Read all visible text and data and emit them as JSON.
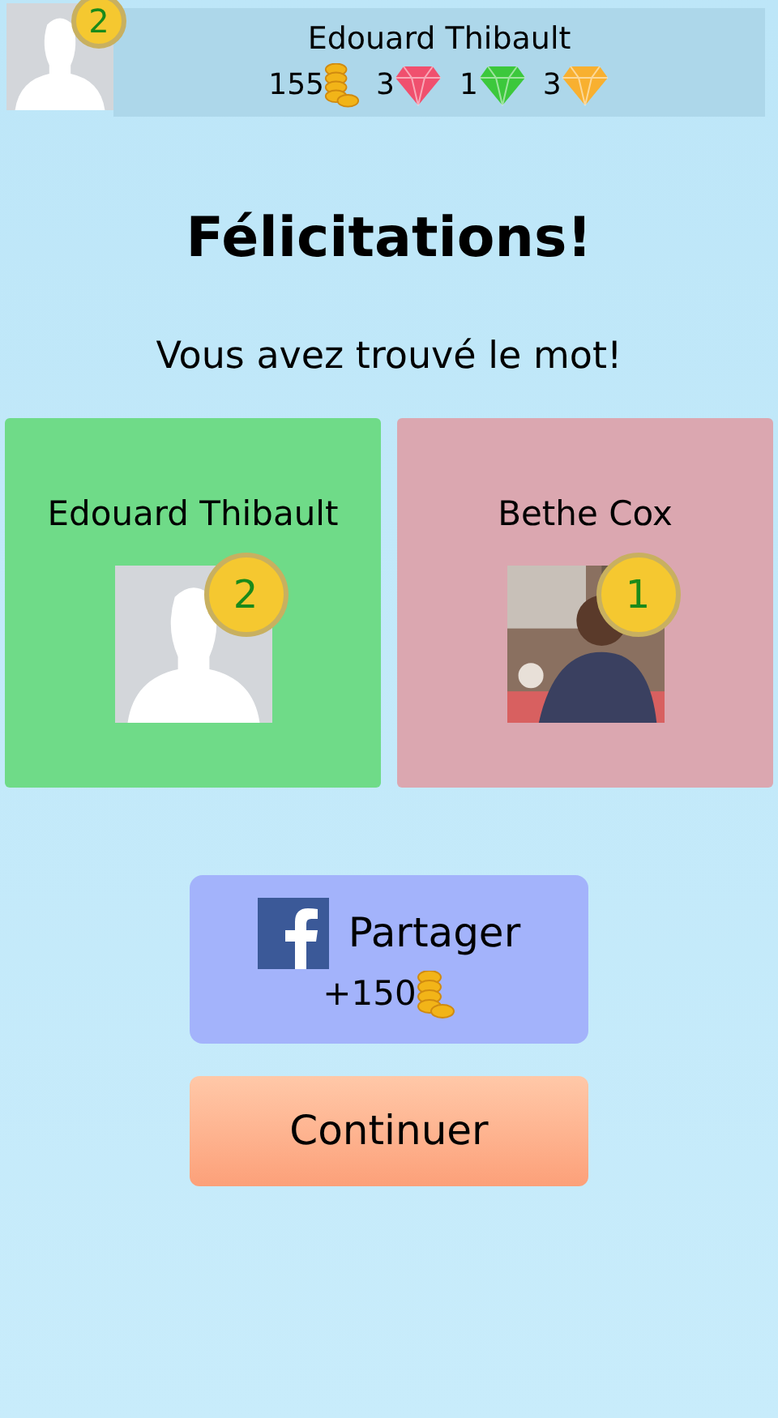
{
  "header": {
    "player": {
      "name": "Edouard Thibault",
      "rank": "2",
      "avatar": {
        "kind": "silhouette"
      }
    },
    "currencies": [
      {
        "kind": "coins",
        "amount": "155"
      },
      {
        "kind": "gem",
        "amount": "3",
        "color": "#f0506e"
      },
      {
        "kind": "gem",
        "amount": "1",
        "color": "#3cc83c"
      },
      {
        "kind": "gem",
        "amount": "3",
        "color": "#f8b030"
      }
    ]
  },
  "title": "Félicitations!",
  "message": "Vous avez trouvé le mot!",
  "players": [
    {
      "name": "Edouard Thibault",
      "rank": "2",
      "avatar": {
        "kind": "silhouette"
      },
      "color": "#6fdb88"
    },
    {
      "name": "Bethe Cox",
      "rank": "1",
      "color": "#dba7b0"
    }
  ],
  "share_button": {
    "label": "Partager",
    "reward": "+150"
  },
  "continue_button": {
    "label": "Continuer"
  }
}
